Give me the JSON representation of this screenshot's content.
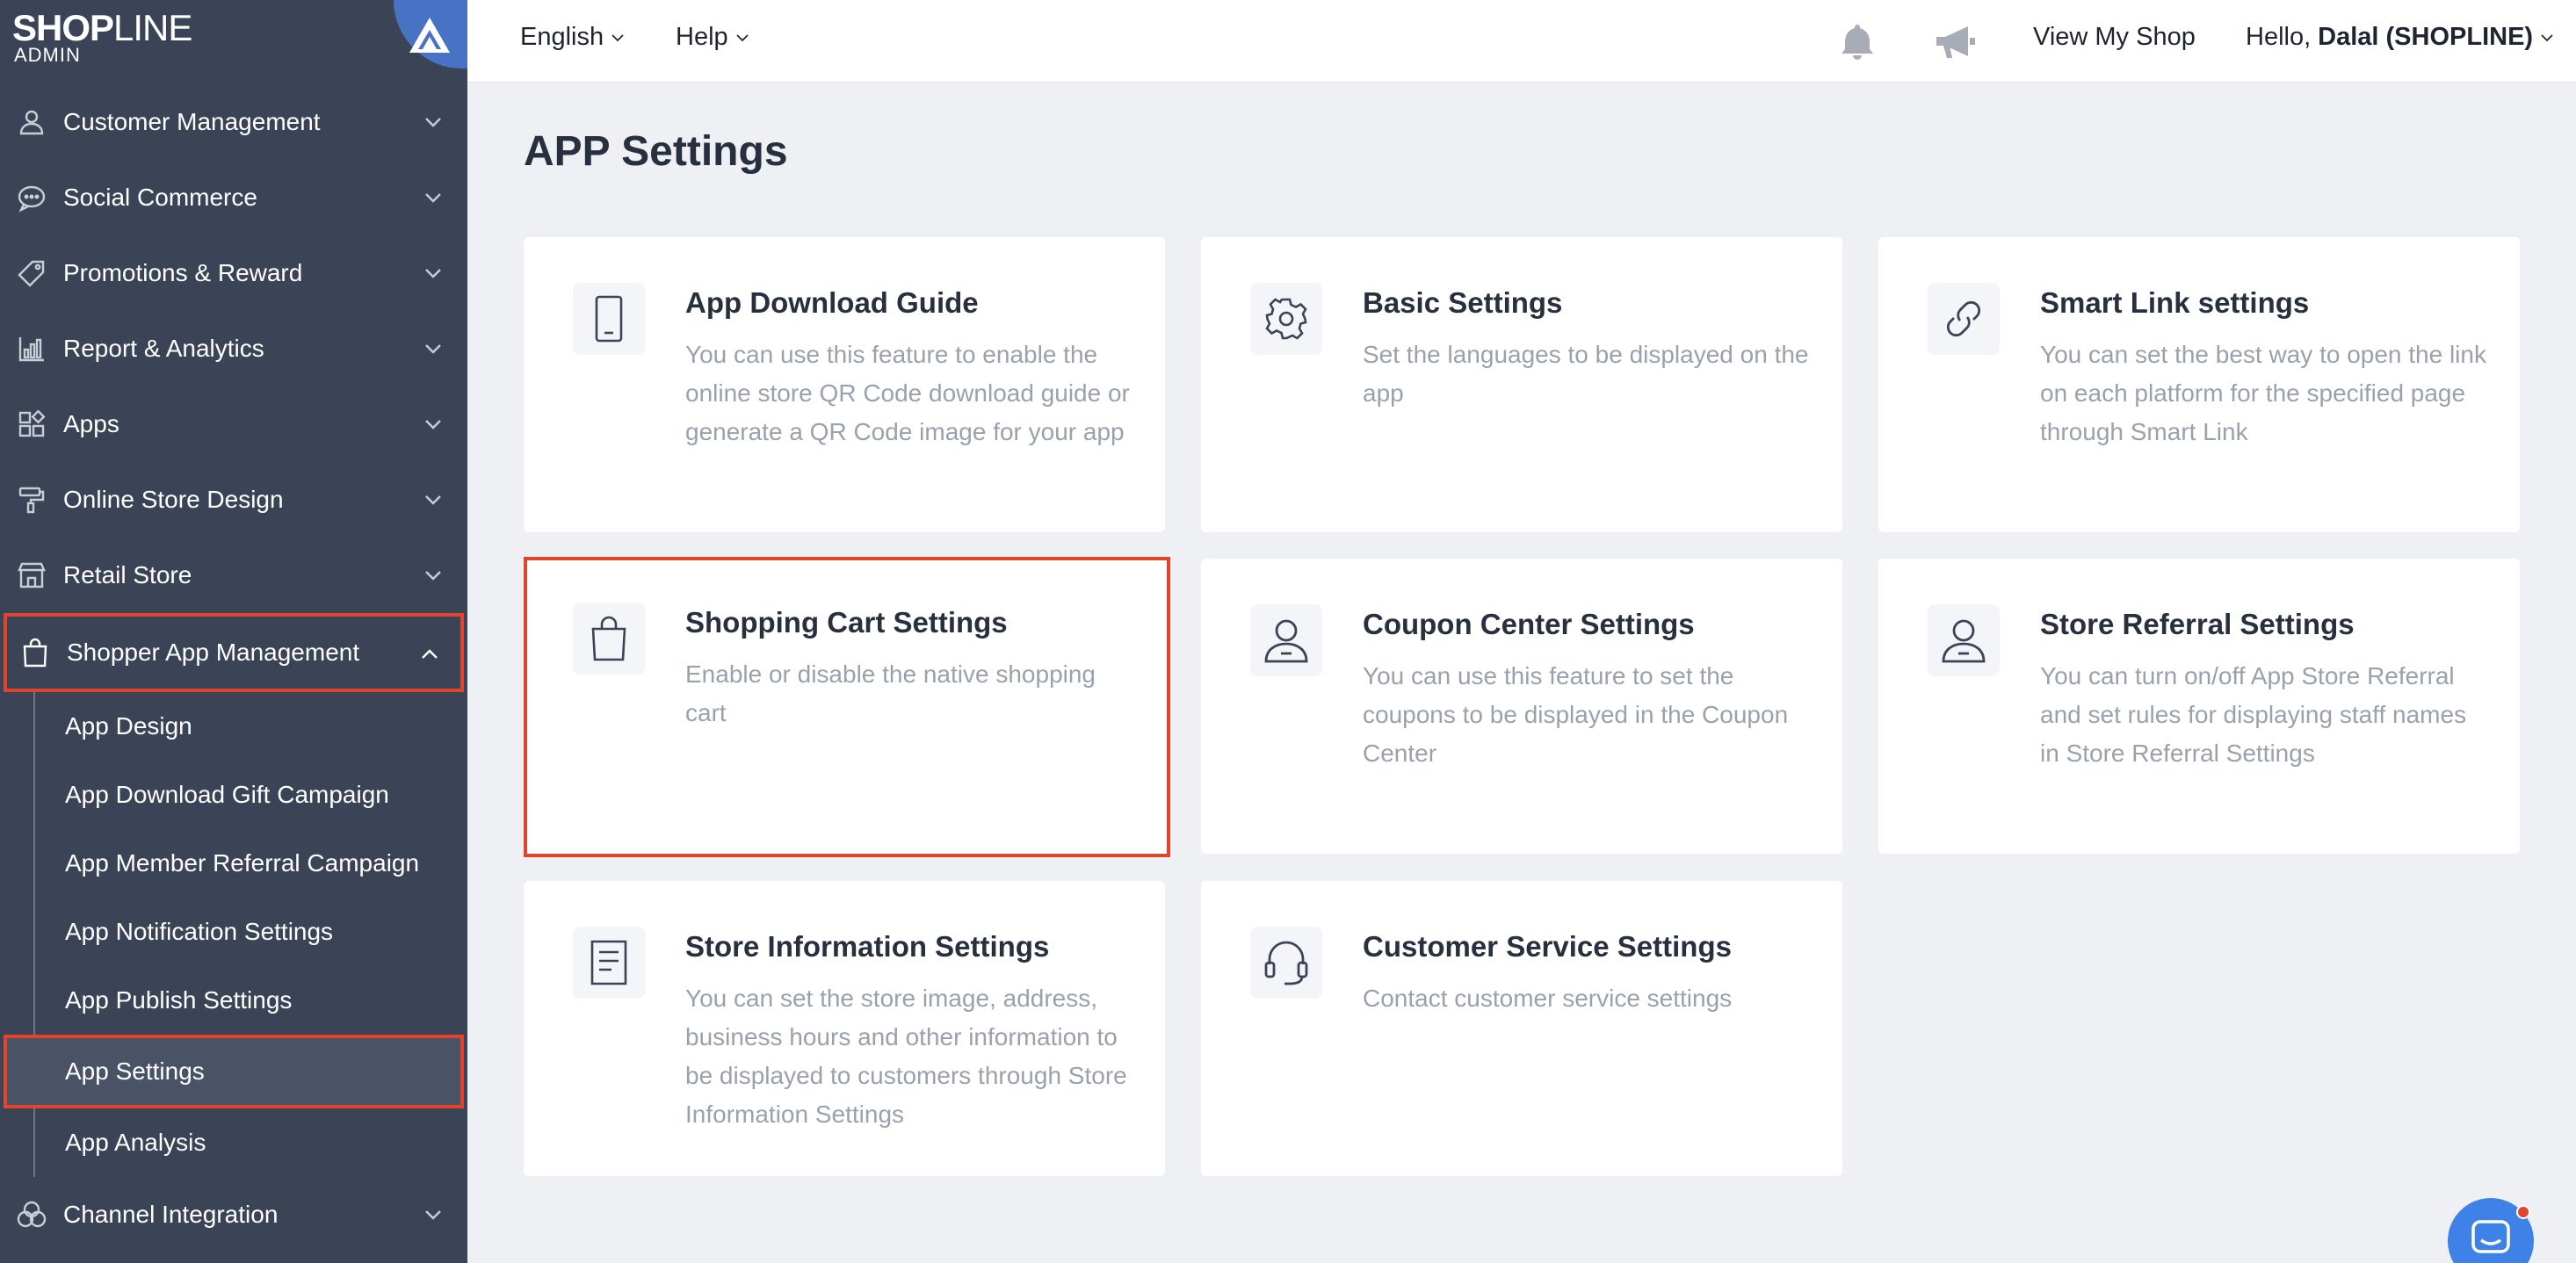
{
  "brand": {
    "name_bold": "SHOP",
    "name_light": "LINE",
    "subtitle": "ADMIN"
  },
  "topbar": {
    "language": "English",
    "help": "Help",
    "view_shop": "View My Shop",
    "greeting": "Hello,",
    "user": "Dalal (SHOPLINE)"
  },
  "sidebar": {
    "items": [
      {
        "label": "Customer Management",
        "icon": "person-icon"
      },
      {
        "label": "Social Commerce",
        "icon": "chat-bubble-icon"
      },
      {
        "label": "Promotions & Reward",
        "icon": "tag-icon"
      },
      {
        "label": "Report & Analytics",
        "icon": "bar-chart-icon"
      },
      {
        "label": "Apps",
        "icon": "apps-grid-icon"
      },
      {
        "label": "Online Store Design",
        "icon": "paint-roller-icon"
      },
      {
        "label": "Retail Store",
        "icon": "storefront-icon"
      },
      {
        "label": "Shopper App Management",
        "icon": "shopping-bag-icon"
      },
      {
        "label": "Channel Integration",
        "icon": "integration-icon"
      }
    ],
    "subitems": [
      {
        "label": "App Design"
      },
      {
        "label": "App Download Gift Campaign"
      },
      {
        "label": "App Member Referral Campaign"
      },
      {
        "label": "App Notification Settings"
      },
      {
        "label": "App Publish Settings"
      },
      {
        "label": "App Settings"
      },
      {
        "label": "App Analysis"
      }
    ]
  },
  "main": {
    "title": "APP Settings",
    "cards": [
      {
        "title": "App Download Guide",
        "desc": "You can use this feature to enable the online store QR Code download guide or generate a QR Code image for your app",
        "icon": "phone-icon"
      },
      {
        "title": "Basic Settings",
        "desc": "Set the languages to be displayed on the app",
        "icon": "gear-icon"
      },
      {
        "title": "Smart Link settings",
        "desc": "You can set the best way to open the link on each platform for the specified page through Smart Link",
        "icon": "link-icon"
      },
      {
        "title": "Shopping Cart Settings",
        "desc": "Enable or disable the native shopping cart",
        "icon": "shopping-bag-icon"
      },
      {
        "title": "Coupon Center Settings",
        "desc": "You can use this feature to set the coupons to be displayed in the Coupon Center",
        "icon": "person-icon"
      },
      {
        "title": "Store Referral Settings",
        "desc": "You can turn on/off App Store Referral and set rules for displaying staff names in Store Referral Settings",
        "icon": "person-icon"
      },
      {
        "title": "Store Information Settings",
        "desc": "You can set the store image, address, business hours and other information to be displayed to customers through Store Information Settings",
        "icon": "document-icon"
      },
      {
        "title": "Customer Service Settings",
        "desc": "Contact customer service settings",
        "icon": "headset-icon"
      }
    ]
  },
  "colors": {
    "sidebar_bg": "#3b4456",
    "highlight": "#e0452b",
    "chat": "#3f82e7"
  }
}
